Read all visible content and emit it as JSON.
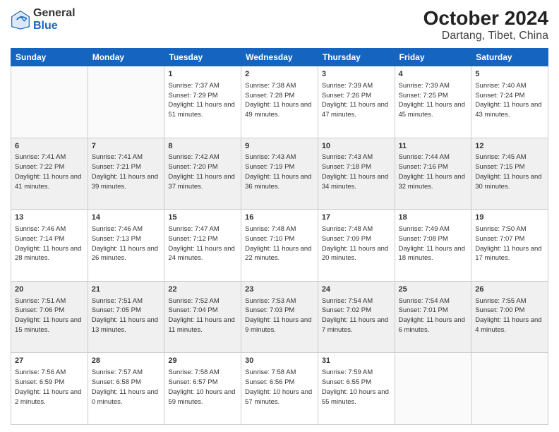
{
  "logo": {
    "line1": "General",
    "line2": "Blue"
  },
  "title": "October 2024",
  "subtitle": "Dartang, Tibet, China",
  "headers": [
    "Sunday",
    "Monday",
    "Tuesday",
    "Wednesday",
    "Thursday",
    "Friday",
    "Saturday"
  ],
  "weeks": [
    [
      {
        "day": "",
        "sunrise": "",
        "sunset": "",
        "daylight": ""
      },
      {
        "day": "",
        "sunrise": "",
        "sunset": "",
        "daylight": ""
      },
      {
        "day": "1",
        "sunrise": "Sunrise: 7:37 AM",
        "sunset": "Sunset: 7:29 PM",
        "daylight": "Daylight: 11 hours and 51 minutes."
      },
      {
        "day": "2",
        "sunrise": "Sunrise: 7:38 AM",
        "sunset": "Sunset: 7:28 PM",
        "daylight": "Daylight: 11 hours and 49 minutes."
      },
      {
        "day": "3",
        "sunrise": "Sunrise: 7:39 AM",
        "sunset": "Sunset: 7:26 PM",
        "daylight": "Daylight: 11 hours and 47 minutes."
      },
      {
        "day": "4",
        "sunrise": "Sunrise: 7:39 AM",
        "sunset": "Sunset: 7:25 PM",
        "daylight": "Daylight: 11 hours and 45 minutes."
      },
      {
        "day": "5",
        "sunrise": "Sunrise: 7:40 AM",
        "sunset": "Sunset: 7:24 PM",
        "daylight": "Daylight: 11 hours and 43 minutes."
      }
    ],
    [
      {
        "day": "6",
        "sunrise": "Sunrise: 7:41 AM",
        "sunset": "Sunset: 7:22 PM",
        "daylight": "Daylight: 11 hours and 41 minutes."
      },
      {
        "day": "7",
        "sunrise": "Sunrise: 7:41 AM",
        "sunset": "Sunset: 7:21 PM",
        "daylight": "Daylight: 11 hours and 39 minutes."
      },
      {
        "day": "8",
        "sunrise": "Sunrise: 7:42 AM",
        "sunset": "Sunset: 7:20 PM",
        "daylight": "Daylight: 11 hours and 37 minutes."
      },
      {
        "day": "9",
        "sunrise": "Sunrise: 7:43 AM",
        "sunset": "Sunset: 7:19 PM",
        "daylight": "Daylight: 11 hours and 36 minutes."
      },
      {
        "day": "10",
        "sunrise": "Sunrise: 7:43 AM",
        "sunset": "Sunset: 7:18 PM",
        "daylight": "Daylight: 11 hours and 34 minutes."
      },
      {
        "day": "11",
        "sunrise": "Sunrise: 7:44 AM",
        "sunset": "Sunset: 7:16 PM",
        "daylight": "Daylight: 11 hours and 32 minutes."
      },
      {
        "day": "12",
        "sunrise": "Sunrise: 7:45 AM",
        "sunset": "Sunset: 7:15 PM",
        "daylight": "Daylight: 11 hours and 30 minutes."
      }
    ],
    [
      {
        "day": "13",
        "sunrise": "Sunrise: 7:46 AM",
        "sunset": "Sunset: 7:14 PM",
        "daylight": "Daylight: 11 hours and 28 minutes."
      },
      {
        "day": "14",
        "sunrise": "Sunrise: 7:46 AM",
        "sunset": "Sunset: 7:13 PM",
        "daylight": "Daylight: 11 hours and 26 minutes."
      },
      {
        "day": "15",
        "sunrise": "Sunrise: 7:47 AM",
        "sunset": "Sunset: 7:12 PM",
        "daylight": "Daylight: 11 hours and 24 minutes."
      },
      {
        "day": "16",
        "sunrise": "Sunrise: 7:48 AM",
        "sunset": "Sunset: 7:10 PM",
        "daylight": "Daylight: 11 hours and 22 minutes."
      },
      {
        "day": "17",
        "sunrise": "Sunrise: 7:48 AM",
        "sunset": "Sunset: 7:09 PM",
        "daylight": "Daylight: 11 hours and 20 minutes."
      },
      {
        "day": "18",
        "sunrise": "Sunrise: 7:49 AM",
        "sunset": "Sunset: 7:08 PM",
        "daylight": "Daylight: 11 hours and 18 minutes."
      },
      {
        "day": "19",
        "sunrise": "Sunrise: 7:50 AM",
        "sunset": "Sunset: 7:07 PM",
        "daylight": "Daylight: 11 hours and 17 minutes."
      }
    ],
    [
      {
        "day": "20",
        "sunrise": "Sunrise: 7:51 AM",
        "sunset": "Sunset: 7:06 PM",
        "daylight": "Daylight: 11 hours and 15 minutes."
      },
      {
        "day": "21",
        "sunrise": "Sunrise: 7:51 AM",
        "sunset": "Sunset: 7:05 PM",
        "daylight": "Daylight: 11 hours and 13 minutes."
      },
      {
        "day": "22",
        "sunrise": "Sunrise: 7:52 AM",
        "sunset": "Sunset: 7:04 PM",
        "daylight": "Daylight: 11 hours and 11 minutes."
      },
      {
        "day": "23",
        "sunrise": "Sunrise: 7:53 AM",
        "sunset": "Sunset: 7:03 PM",
        "daylight": "Daylight: 11 hours and 9 minutes."
      },
      {
        "day": "24",
        "sunrise": "Sunrise: 7:54 AM",
        "sunset": "Sunset: 7:02 PM",
        "daylight": "Daylight: 11 hours and 7 minutes."
      },
      {
        "day": "25",
        "sunrise": "Sunrise: 7:54 AM",
        "sunset": "Sunset: 7:01 PM",
        "daylight": "Daylight: 11 hours and 6 minutes."
      },
      {
        "day": "26",
        "sunrise": "Sunrise: 7:55 AM",
        "sunset": "Sunset: 7:00 PM",
        "daylight": "Daylight: 11 hours and 4 minutes."
      }
    ],
    [
      {
        "day": "27",
        "sunrise": "Sunrise: 7:56 AM",
        "sunset": "Sunset: 6:59 PM",
        "daylight": "Daylight: 11 hours and 2 minutes."
      },
      {
        "day": "28",
        "sunrise": "Sunrise: 7:57 AM",
        "sunset": "Sunset: 6:58 PM",
        "daylight": "Daylight: 11 hours and 0 minutes."
      },
      {
        "day": "29",
        "sunrise": "Sunrise: 7:58 AM",
        "sunset": "Sunset: 6:57 PM",
        "daylight": "Daylight: 10 hours and 59 minutes."
      },
      {
        "day": "30",
        "sunrise": "Sunrise: 7:58 AM",
        "sunset": "Sunset: 6:56 PM",
        "daylight": "Daylight: 10 hours and 57 minutes."
      },
      {
        "day": "31",
        "sunrise": "Sunrise: 7:59 AM",
        "sunset": "Sunset: 6:55 PM",
        "daylight": "Daylight: 10 hours and 55 minutes."
      },
      {
        "day": "",
        "sunrise": "",
        "sunset": "",
        "daylight": ""
      },
      {
        "day": "",
        "sunrise": "",
        "sunset": "",
        "daylight": ""
      }
    ]
  ]
}
